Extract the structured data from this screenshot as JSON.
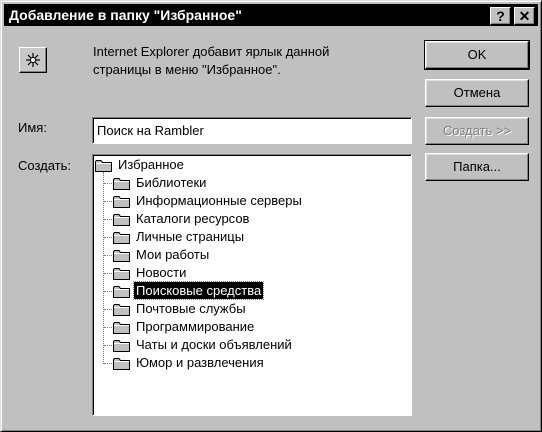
{
  "window": {
    "title": "Добавление в папку \"Избранное\"",
    "help_glyph": "?",
    "close_glyph": "✕"
  },
  "info": {
    "line1": "Internet Explorer добавит ярлык данной",
    "line2": "страницы в меню \"Избранное\"."
  },
  "buttons": {
    "ok": "OK",
    "cancel": "Отмена",
    "create": "Создать >>",
    "folder": "Папка..."
  },
  "form": {
    "name_label": "Имя:",
    "name_value": "Поиск на Rambler",
    "create_in_label": "Создать:"
  },
  "tree": {
    "root": "Избранное",
    "items": [
      "Библиотеки",
      "Информационные серверы",
      "Каталоги ресурсов",
      "Личные страницы",
      "Мои работы",
      "Новости",
      "Поисковые средства",
      "Почтовые службы",
      "Программирование",
      "Чаты и доски объявлений",
      "Юмор и развлечения"
    ],
    "selected_index": 6
  },
  "icons": {
    "favorites": "favorites-star-icon",
    "folder": "folder-icon",
    "help": "help-icon",
    "close": "close-icon"
  }
}
